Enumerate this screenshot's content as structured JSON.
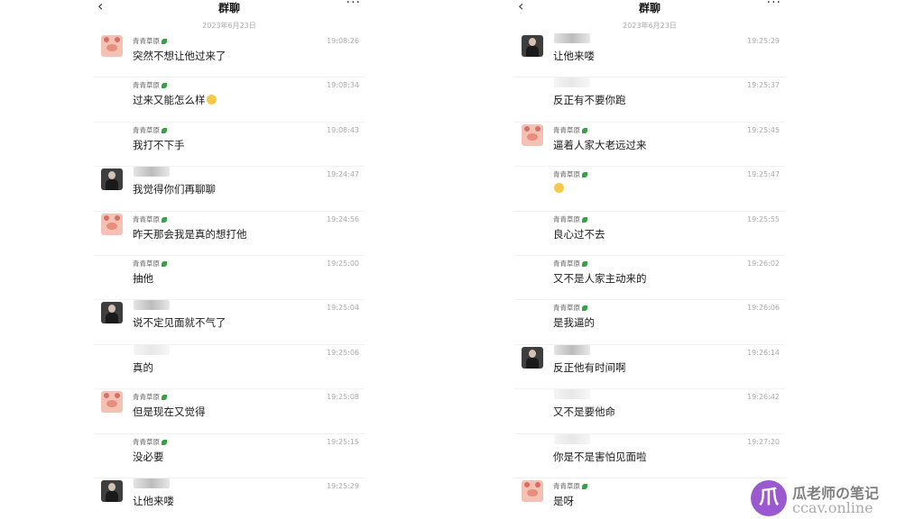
{
  "left": {
    "title": "群聊",
    "date": "2023年6月23日",
    "messages": [
      {
        "sender": "青青草原",
        "avatar": "pig",
        "time": "19:08:26",
        "text": "突然不想让他过来了"
      },
      {
        "sender": "青青草原",
        "avatar": "none",
        "time": "19:08:34",
        "text": "过来又能怎么样",
        "emoji": true
      },
      {
        "sender": "青青草原",
        "avatar": "none",
        "time": "19:08:43",
        "text": "我打不下手"
      },
      {
        "sender": "",
        "avatar": "photo",
        "time": "19:24:47",
        "text": "我觉得你们再聊聊"
      },
      {
        "sender": "青青草原",
        "avatar": "pig",
        "time": "19:24:56",
        "text": "昨天那会我是真的想打他"
      },
      {
        "sender": "青青草原",
        "avatar": "none",
        "time": "19:25:00",
        "text": "抽他"
      },
      {
        "sender": "",
        "avatar": "photo",
        "time": "19:25:04",
        "text": "说不定见面就不气了"
      },
      {
        "sender": "",
        "avatar": "none",
        "time": "19:25:06",
        "text": "真的"
      },
      {
        "sender": "青青草原",
        "avatar": "pig",
        "time": "19:25:08",
        "text": "但是现在又觉得"
      },
      {
        "sender": "青青草原",
        "avatar": "none",
        "time": "19:25:15",
        "text": "没必要"
      },
      {
        "sender": "",
        "avatar": "photo",
        "time": "19:25:29",
        "text": "让他来喽"
      }
    ]
  },
  "right": {
    "title": "群聊",
    "date": "2023年6月23日",
    "messages": [
      {
        "sender": "",
        "avatar": "photo",
        "time": "19:25:29",
        "text": "让他来喽"
      },
      {
        "sender": "",
        "avatar": "none",
        "time": "19:25:37",
        "text": "反正有不要你跑"
      },
      {
        "sender": "青青草原",
        "avatar": "pig",
        "time": "19:25:45",
        "text": "逼着人家大老远过来"
      },
      {
        "sender": "青青草原",
        "avatar": "none",
        "time": "19:25:47",
        "text": "",
        "emoji": true
      },
      {
        "sender": "青青草原",
        "avatar": "none",
        "time": "19:25:55",
        "text": "良心过不去"
      },
      {
        "sender": "青青草原",
        "avatar": "none",
        "time": "19:26:02",
        "text": "又不是人家主动来的"
      },
      {
        "sender": "青青草原",
        "avatar": "none",
        "time": "19:26:06",
        "text": "是我逼的"
      },
      {
        "sender": "",
        "avatar": "photo",
        "time": "19:26:14",
        "text": "反正他有时间啊"
      },
      {
        "sender": "",
        "avatar": "none",
        "time": "19:26:42",
        "text": "又不是要他命"
      },
      {
        "sender": "",
        "avatar": "none",
        "time": "19:27:20",
        "text": "你是不是害怕见面啦"
      },
      {
        "sender": "青青草原",
        "avatar": "pig",
        "time": "",
        "text": "是呀"
      }
    ]
  },
  "watermark": {
    "logo_char": "爪",
    "title": "瓜老师の笔记",
    "url": "ccav.online"
  },
  "icons": {
    "back": "chevron-left-icon",
    "more": "more-dots-icon"
  }
}
